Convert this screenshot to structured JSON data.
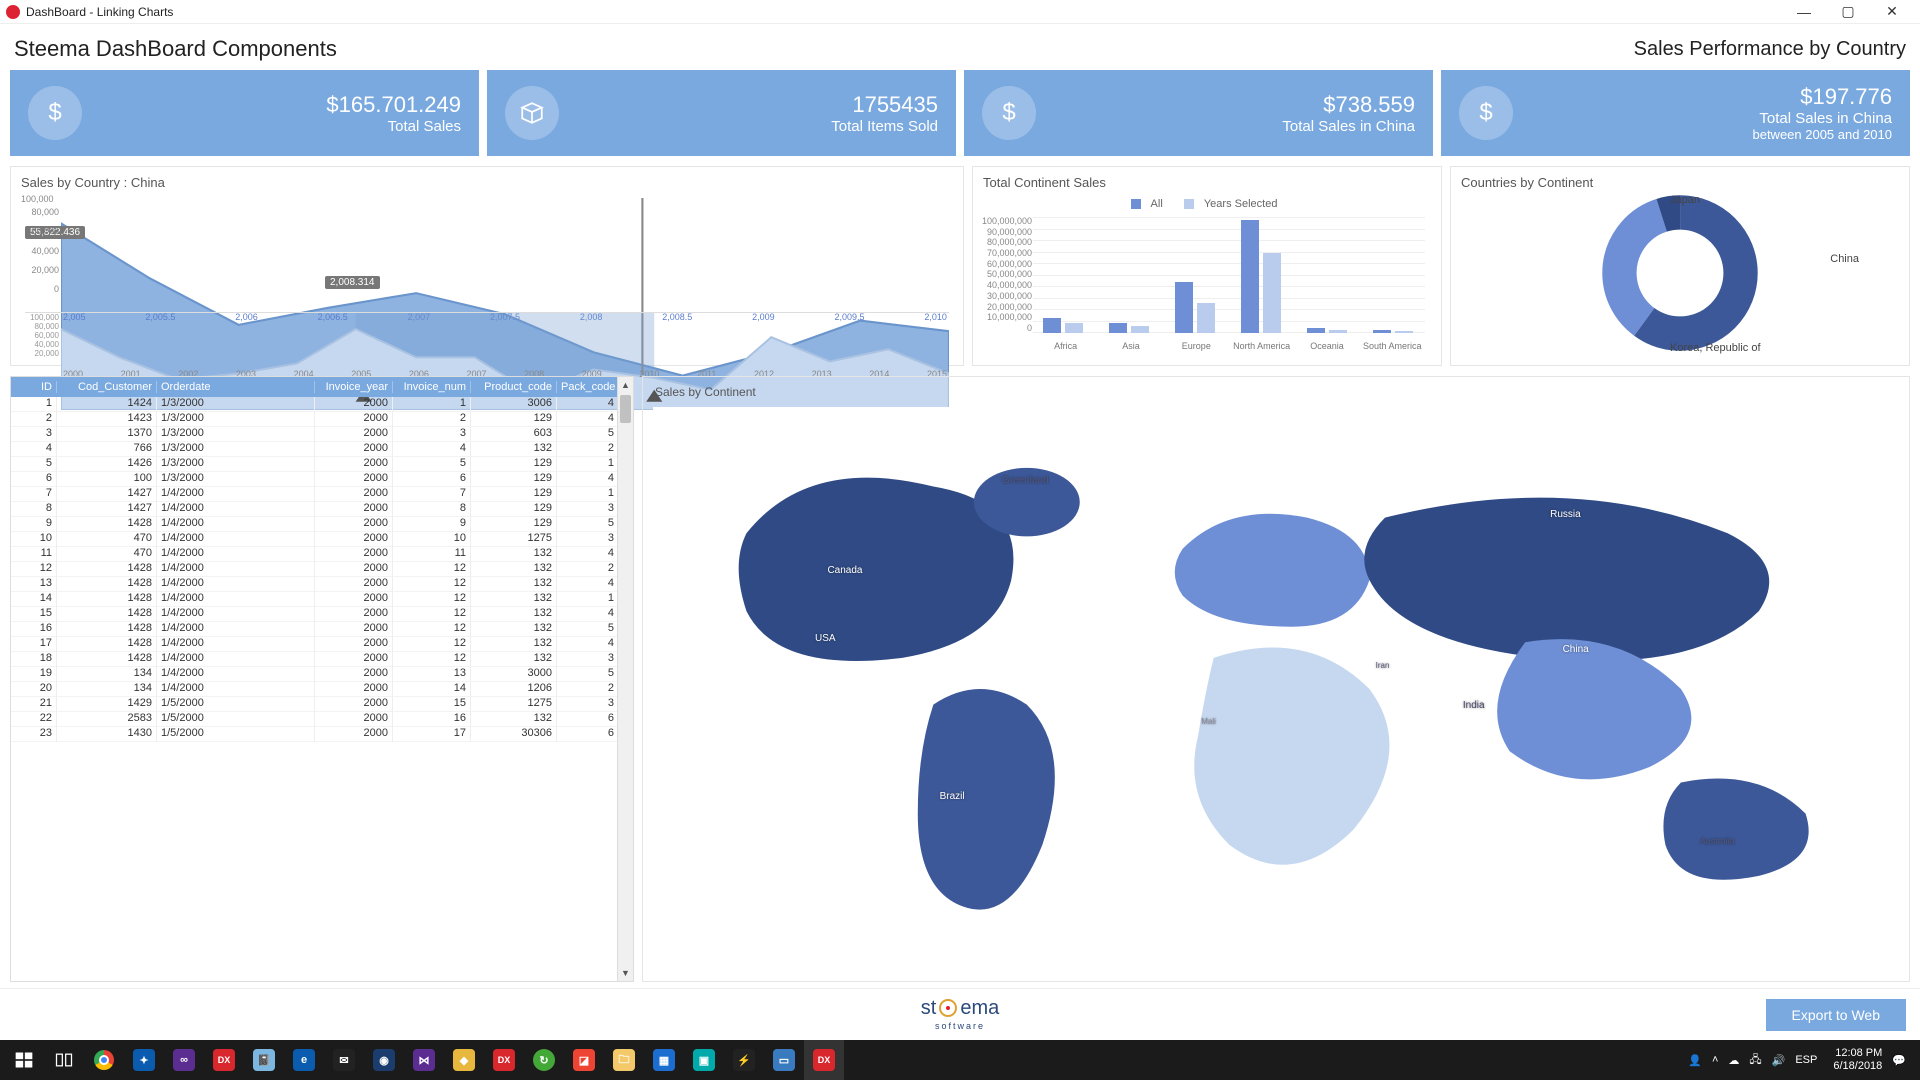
{
  "window": {
    "title": "DashBoard - Linking Charts"
  },
  "header": {
    "left": "Steema DashBoard Components",
    "right": "Sales Performance by Country"
  },
  "kpis": [
    {
      "icon": "dollar",
      "value": "$165.701.249",
      "label": "Total Sales",
      "sub": ""
    },
    {
      "icon": "box",
      "value": "1755435",
      "label": "Total Items Sold",
      "sub": ""
    },
    {
      "icon": "dollar",
      "value": "$738.559",
      "label": "Total Sales in China",
      "sub": ""
    },
    {
      "icon": "dollar",
      "value": "$197.776",
      "label": "Total Sales in China",
      "sub": "between 2005 and 2010"
    }
  ],
  "area_panel": {
    "title": "Sales by Country : China",
    "marker_y": "55,822.436",
    "marker_x": "2,008.314",
    "y_ticks": [
      "100,000",
      "80,000",
      "60,000",
      "40,000",
      "20,000",
      "0"
    ],
    "x_ticks": [
      "2,005",
      "2,005.5",
      "2,006",
      "2,006.5",
      "2,007",
      "2,007.5",
      "2,008",
      "2,008.5",
      "2,009",
      "2,009.5",
      "2,010"
    ],
    "mini_y_ticks": [
      "100,000",
      "80,000",
      "60,000",
      "40,000",
      "20,000"
    ],
    "mini_x_ticks": [
      "2000",
      "2001",
      "2002",
      "2003",
      "2004",
      "2005",
      "2006",
      "2007",
      "2008",
      "2009",
      "2010",
      "2011",
      "2012",
      "2013",
      "2014",
      "2015"
    ]
  },
  "bar_panel": {
    "title": "Total Continent Sales",
    "legend": {
      "a": "All",
      "b": "Years Selected"
    },
    "y_ticks": [
      "100,000,000",
      "90,000,000",
      "80,000,000",
      "70,000,000",
      "60,000,000",
      "50,000,000",
      "40,000,000",
      "30,000,000",
      "20,000,000",
      "10,000,000",
      "0"
    ]
  },
  "donut_panel": {
    "title": "Countries by Continent",
    "labels": {
      "top": "Japan",
      "right": "China",
      "bottom": "Korea, Republic of"
    }
  },
  "grid": {
    "columns": [
      "ID",
      "Cod_Customer",
      "Orderdate",
      "Invoice_year",
      "Invoice_num",
      "Product_code",
      "Pack_code"
    ],
    "rows": [
      [
        1,
        1424,
        "1/3/2000",
        2000,
        1,
        3006,
        4
      ],
      [
        2,
        1423,
        "1/3/2000",
        2000,
        2,
        129,
        4
      ],
      [
        3,
        1370,
        "1/3/2000",
        2000,
        3,
        603,
        5
      ],
      [
        4,
        766,
        "1/3/2000",
        2000,
        4,
        132,
        2
      ],
      [
        5,
        1426,
        "1/3/2000",
        2000,
        5,
        129,
        1
      ],
      [
        6,
        100,
        "1/3/2000",
        2000,
        6,
        129,
        4
      ],
      [
        7,
        1427,
        "1/4/2000",
        2000,
        7,
        129,
        1
      ],
      [
        8,
        1427,
        "1/4/2000",
        2000,
        8,
        129,
        3
      ],
      [
        9,
        1428,
        "1/4/2000",
        2000,
        9,
        129,
        5
      ],
      [
        10,
        470,
        "1/4/2000",
        2000,
        10,
        1275,
        3
      ],
      [
        11,
        470,
        "1/4/2000",
        2000,
        11,
        132,
        4
      ],
      [
        12,
        1428,
        "1/4/2000",
        2000,
        12,
        132,
        2
      ],
      [
        13,
        1428,
        "1/4/2000",
        2000,
        12,
        132,
        4
      ],
      [
        14,
        1428,
        "1/4/2000",
        2000,
        12,
        132,
        1
      ],
      [
        15,
        1428,
        "1/4/2000",
        2000,
        12,
        132,
        4
      ],
      [
        16,
        1428,
        "1/4/2000",
        2000,
        12,
        132,
        5
      ],
      [
        17,
        1428,
        "1/4/2000",
        2000,
        12,
        132,
        4
      ],
      [
        18,
        1428,
        "1/4/2000",
        2000,
        12,
        132,
        3
      ],
      [
        19,
        134,
        "1/4/2000",
        2000,
        13,
        3000,
        5
      ],
      [
        20,
        134,
        "1/4/2000",
        2000,
        14,
        1206,
        2
      ],
      [
        21,
        1429,
        "1/5/2000",
        2000,
        15,
        1275,
        3
      ],
      [
        22,
        2583,
        "1/5/2000",
        2000,
        16,
        132,
        6
      ],
      [
        23,
        1430,
        "1/5/2000",
        2000,
        17,
        30306,
        6
      ]
    ]
  },
  "map_panel": {
    "title": "Sales by Continent",
    "labels": {
      "usa": "USA",
      "canada": "Canada",
      "greenland": "Greenland",
      "brazil": "Brazil",
      "russia": "Russia",
      "china": "China",
      "india": "India",
      "iran": "Iran",
      "mali": "Mali",
      "australia": "Australia"
    }
  },
  "footer": {
    "export": "Export to Web",
    "logo_top": "steema",
    "logo_sub": "software"
  },
  "taskbar": {
    "lang": "ESP",
    "time": "12:08 PM",
    "date": "6/18/2018"
  },
  "chart_data": [
    {
      "type": "area",
      "title": "Sales by Country : China",
      "x": [
        2005,
        2005.5,
        2006,
        2006.5,
        2007,
        2007.5,
        2008,
        2008.5,
        2009,
        2009.5,
        2010
      ],
      "y": [
        82000,
        60000,
        35000,
        43000,
        50000,
        40000,
        20000,
        8000,
        20000,
        33000,
        28000
      ],
      "ylim": [
        0,
        100000
      ],
      "annotations": [
        {
          "x": 2005,
          "y": 55822.436,
          "text": "55,822.436"
        },
        {
          "x": 2008.314,
          "text": "2,008.314"
        }
      ],
      "overview": {
        "x_range": [
          2000,
          2015
        ],
        "selected_range": [
          2005,
          2010
        ],
        "series": [
          82000,
          52000,
          30000,
          35000,
          48000,
          82000,
          50000,
          50000,
          20000,
          33000,
          28000,
          18000,
          70000,
          48000,
          60000,
          38000
        ]
      }
    },
    {
      "type": "bar",
      "title": "Total Continent Sales",
      "categories": [
        "Africa",
        "Asia",
        "Europe",
        "North America",
        "Oceania",
        "South America"
      ],
      "series": [
        {
          "name": "All",
          "values": [
            13000000,
            9000000,
            44000000,
            98000000,
            4000000,
            3000000
          ]
        },
        {
          "name": "Years Selected",
          "values": [
            9000000,
            6000000,
            26000000,
            70000000,
            2500000,
            2000000
          ]
        }
      ],
      "ylabel": "",
      "ylim": [
        0,
        100000000
      ]
    },
    {
      "type": "pie",
      "title": "Countries by Continent",
      "categories": [
        "Japan",
        "China",
        "Korea, Republic of"
      ],
      "values": [
        60,
        5,
        35
      ]
    }
  ]
}
